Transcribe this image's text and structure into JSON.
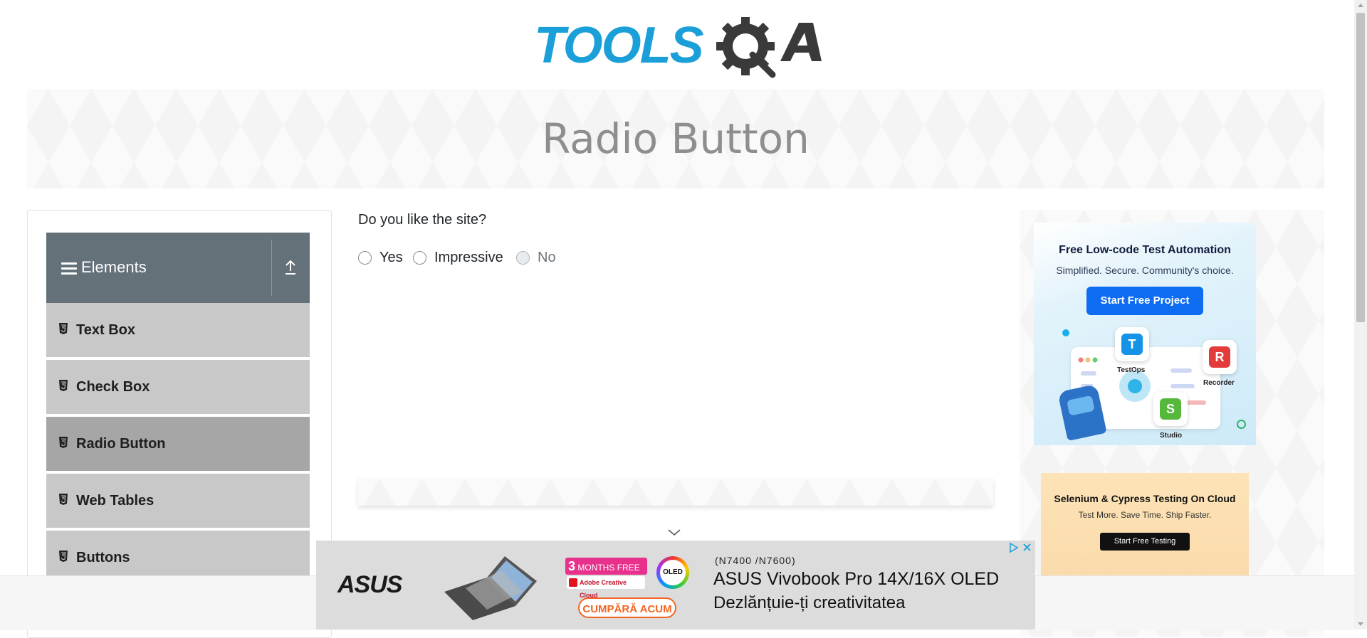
{
  "header": {
    "logo_text": "TOOLSQA",
    "logo_colors": {
      "tools": "#1a9fd8",
      "qa": "#3a3a3a"
    }
  },
  "banner": {
    "title": "Radio Button"
  },
  "sidebar": {
    "group_title": "Elements",
    "items": [
      {
        "label": "Text Box",
        "active": false
      },
      {
        "label": "Check Box",
        "active": false
      },
      {
        "label": "Radio Button",
        "active": true
      },
      {
        "label": "Web Tables",
        "active": false
      },
      {
        "label": "Buttons",
        "active": false
      }
    ]
  },
  "main": {
    "question": "Do you like the site?",
    "options": [
      {
        "label": "Yes",
        "disabled": false,
        "checked": false
      },
      {
        "label": "Impressive",
        "disabled": false,
        "checked": false
      },
      {
        "label": "No",
        "disabled": true,
        "checked": false
      }
    ]
  },
  "ads": {
    "right_top": {
      "headline": "Free Low-code Test Automation",
      "subline": "Simplified. Secure. Community's choice.",
      "button": "Start Free Project",
      "apps": [
        "TestOps",
        "Recorder",
        "Studio"
      ]
    },
    "right_bottom": {
      "headline": "Selenium & Cypress Testing On Cloud",
      "subline": "Test More. Save Time. Ship Faster.",
      "button": "Start Free Testing"
    },
    "bottom": {
      "brand": "ASUS",
      "promo_number": "3",
      "promo_text": "MONTHS FREE",
      "adobe": "Adobe Creative Cloud",
      "oled_badge": "OLED",
      "cta": "CUMPĂRĂ ACUM",
      "model": "(N7400 /N7600)",
      "line1": "ASUS Vivobook Pro 14X/16X OLED",
      "line2": "Dezlănțuie-ți creativitatea"
    }
  },
  "colors": {
    "accent": "#1a9fd8",
    "sidebar_header": "#647179",
    "menu_item": "#c8c8c8",
    "menu_active": "#a6a6a6"
  }
}
